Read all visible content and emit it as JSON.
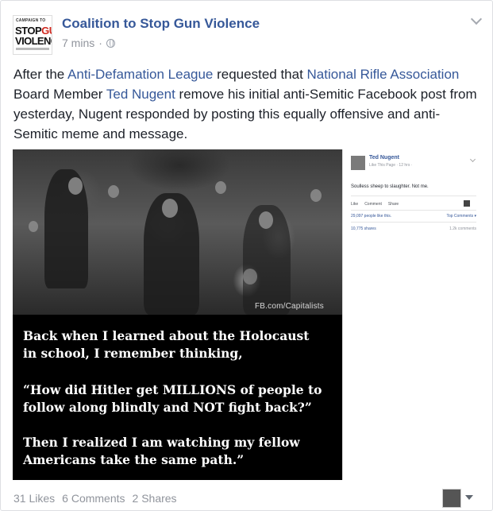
{
  "post": {
    "page_name": "Coalition to Stop Gun Violence",
    "time": "7 mins",
    "separator": "·",
    "privacy_icon": "globe-icon",
    "text_parts": [
      {
        "t": "After the ",
        "link": false
      },
      {
        "t": "Anti-Defamation League",
        "link": true
      },
      {
        "t": " requested that ",
        "link": false
      },
      {
        "t": "National Rifle Association",
        "link": true
      },
      {
        "t": " Board Member ",
        "link": false
      },
      {
        "t": "Ted Nugent",
        "link": true
      },
      {
        "t": " remove his initial anti-Semitic Facebook post from yesterday, Nugent responded by posting this equally offensive and anti-Semitic meme and message.",
        "link": false
      }
    ]
  },
  "avatar_logo": {
    "line1": "CAMPAIGN TO",
    "line2a": "STOP",
    "line2b": "GUN",
    "line3": "VIOLENCE"
  },
  "image": {
    "watermark": "FB.com/Capitalists",
    "meme_lines": [
      "Back when I learned about the Holocaust",
      "in school, I remember thinking,",
      "“How did Hitler get MILLIONS of people to",
      "follow along blindly and NOT fight back?”",
      "Then I realized I am watching my fellow",
      "Americans take the same path.”"
    ],
    "fb_snippet": {
      "name": "Ted Nugent",
      "sub": "Like This Page · 12 hrs ·",
      "text": "Soulless sheep to slaughter. Not me.",
      "like": "Like",
      "comment": "Comment",
      "share": "Share",
      "likes": "29,097 people like this.",
      "top_comments": "Top Comments ▾",
      "shares": "10,775 shares",
      "comments": "1.2k comments"
    }
  },
  "footer": {
    "likes": "31 Likes",
    "comments": "6 Comments",
    "shares": "2 Shares"
  },
  "colors": {
    "link": "#365899",
    "meta": "#90949c",
    "text": "#1d2129"
  }
}
